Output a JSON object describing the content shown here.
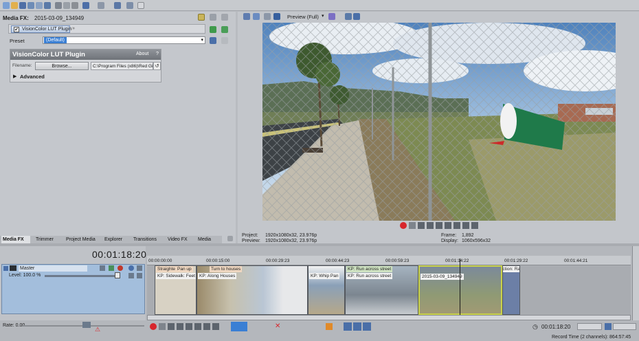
{
  "media_fx": {
    "title": "Media FX:",
    "clip_name": "2015-03-09_134949",
    "plugin_chip": "VisionColor LUT Plugin",
    "preset_label": "Preset",
    "preset_value": "(Default)",
    "plugin_title": "VisionColor LUT Plugin",
    "about_label": "About",
    "help_label": "?",
    "filename_label": "Filename:",
    "browse_label": "Browse...",
    "path_value": "C:\\Program Files (x86)\\Red Gir",
    "advanced_label": "Advanced"
  },
  "tabs": [
    "Media FX",
    "Trimmer",
    "Project Media",
    "Explorer",
    "Transitions",
    "Video FX",
    "Media Gen"
  ],
  "preview": {
    "mode_label": "Preview (Full)",
    "project_label": "Project:",
    "project_value": "1920x1080x32, 23.976p",
    "preview_label": "Preview:",
    "preview_value": "1920x1080x32, 23.976p",
    "frame_label": "Frame:",
    "frame_value": "1,892",
    "display_label": "Display:",
    "display_value": "1060x596x32"
  },
  "timeline": {
    "timecode": "00:01:18:20",
    "ruler_ticks": [
      "00:00:00:00",
      "00:00:15:00",
      "00:00:29:23",
      "00:00:44:23",
      "00:00:59:23",
      "00:01:14:22",
      "00:01:29:22",
      "00:01:44:21"
    ],
    "track_name": "Master",
    "level_label": "Level: 100.0 %",
    "rate_label": "Rate: 0.00",
    "clips": [
      {
        "top": "Straighte",
        "top2": "Pan up",
        "kp": "KP: Sidewalk: Feet V"
      },
      {
        "top": "Turn to houses",
        "kp": "KP: Along Houses"
      },
      {
        "top": "",
        "kp": "KP: Whip Pan"
      },
      {
        "top": "KP: Run across street",
        "kp": "KP: Run across street"
      },
      {
        "top": "",
        "kp": "2015-03-09_134949"
      },
      {
        "top": "Side: Construction: Rae",
        "kp": ""
      }
    ],
    "bottom_timecode": "00:01:18:20",
    "record_time": "Record Time (2 channels): 864:57:45"
  },
  "colors": {
    "record_red": "#d7262c",
    "track_blue": "#a3bedc",
    "selection_blue": "#3a7fd4"
  }
}
